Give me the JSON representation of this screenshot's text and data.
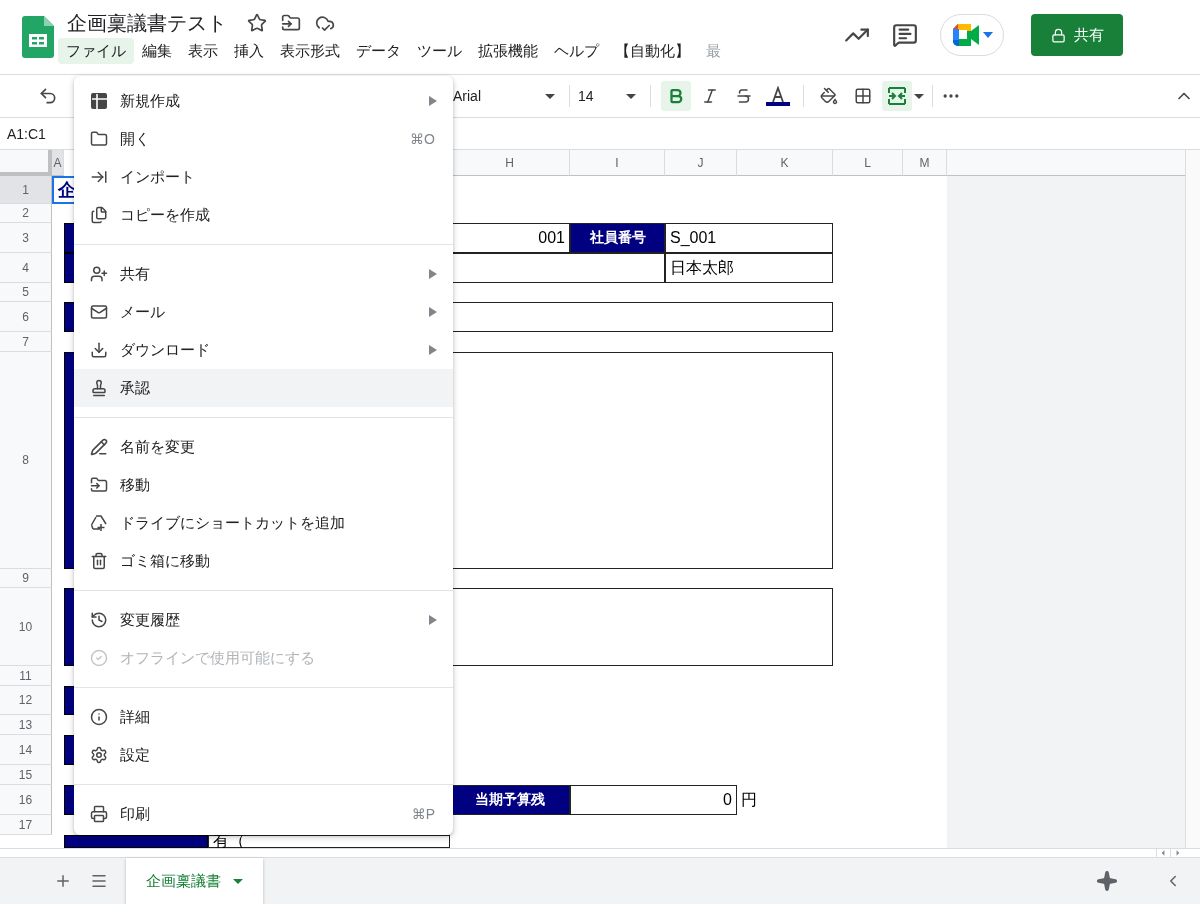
{
  "app": {
    "title": "企画稟議書テスト"
  },
  "menubar": [
    {
      "label": "ファイル",
      "selected": true
    },
    {
      "label": "編集",
      "selected": false
    },
    {
      "label": "表示",
      "selected": false
    },
    {
      "label": "挿入",
      "selected": false
    },
    {
      "label": "表示形式",
      "selected": false
    },
    {
      "label": "データ",
      "selected": false
    },
    {
      "label": "ツール",
      "selected": false
    },
    {
      "label": "拡張機能",
      "selected": false
    },
    {
      "label": "ヘルプ",
      "selected": false
    },
    {
      "label": "【自動化】",
      "selected": false
    },
    {
      "label": "最",
      "selected": false
    }
  ],
  "share_button": {
    "label": "共有"
  },
  "toolbar": {
    "font": "Arial",
    "font_size": "14",
    "bold": true,
    "italic": false,
    "strikethrough": false,
    "merge": true
  },
  "name_box": "A1:C1",
  "sheet": {
    "column_headers": [
      {
        "label": "A",
        "selected": true
      },
      {
        "label": "H",
        "selected": false
      },
      {
        "label": "I",
        "selected": false
      },
      {
        "label": "J",
        "selected": false
      },
      {
        "label": "K",
        "selected": false
      },
      {
        "label": "L",
        "selected": false
      },
      {
        "label": "M",
        "selected": false
      }
    ],
    "row_headers": [
      {
        "label": "1",
        "selected": true
      },
      {
        "label": "2",
        "selected": false
      },
      {
        "label": "3",
        "selected": false
      },
      {
        "label": "4",
        "selected": false
      },
      {
        "label": "5",
        "selected": false
      },
      {
        "label": "6",
        "selected": false
      },
      {
        "label": "7",
        "selected": false
      },
      {
        "label": "8",
        "selected": false
      },
      {
        "label": "9",
        "selected": false
      },
      {
        "label": "10",
        "selected": false
      },
      {
        "label": "11",
        "selected": false
      },
      {
        "label": "12",
        "selected": false
      },
      {
        "label": "13",
        "selected": false
      },
      {
        "label": "14",
        "selected": false
      },
      {
        "label": "15",
        "selected": false
      },
      {
        "label": "16",
        "selected": false
      },
      {
        "label": "17",
        "selected": false
      }
    ],
    "cells": [
      {
        "text": "企",
        "kind": "title",
        "selected": true
      },
      {
        "text": "001",
        "kind": "number",
        "selected": false
      },
      {
        "text": "社員番号",
        "kind": "label",
        "selected": false
      },
      {
        "text": "S_001",
        "kind": "text",
        "selected": false
      },
      {
        "text": "日本太郎",
        "kind": "text",
        "selected": false
      },
      {
        "text": "当期予算残",
        "kind": "label",
        "selected": false
      },
      {
        "text": "0",
        "kind": "number",
        "selected": false
      },
      {
        "text": "円",
        "kind": "unit",
        "selected": false
      },
      {
        "text": "有（",
        "kind": "text",
        "selected": false
      }
    ]
  },
  "file_menu": {
    "sections": [
      [
        {
          "label": "新規作成",
          "submenu": true,
          "highlighted": false,
          "disabled": false
        },
        {
          "label": "開く",
          "shortcut": "⌘O",
          "submenu": false,
          "highlighted": false,
          "disabled": false
        },
        {
          "label": "インポート",
          "submenu": false,
          "highlighted": false,
          "disabled": false
        },
        {
          "label": "コピーを作成",
          "submenu": false,
          "highlighted": false,
          "disabled": false
        }
      ],
      [
        {
          "label": "共有",
          "submenu": true,
          "highlighted": false,
          "disabled": false
        },
        {
          "label": "メール",
          "submenu": true,
          "highlighted": false,
          "disabled": false
        },
        {
          "label": "ダウンロード",
          "submenu": true,
          "highlighted": false,
          "disabled": false
        },
        {
          "label": "承認",
          "submenu": false,
          "highlighted": true,
          "disabled": false
        }
      ],
      [
        {
          "label": "名前を変更",
          "submenu": false,
          "highlighted": false,
          "disabled": false
        },
        {
          "label": "移動",
          "submenu": false,
          "highlighted": false,
          "disabled": false
        },
        {
          "label": "ドライブにショートカットを追加",
          "submenu": false,
          "highlighted": false,
          "disabled": false
        },
        {
          "label": "ゴミ箱に移動",
          "submenu": false,
          "highlighted": false,
          "disabled": false
        }
      ],
      [
        {
          "label": "変更履歴",
          "submenu": true,
          "highlighted": false,
          "disabled": false
        },
        {
          "label": "オフラインで使用可能にする",
          "submenu": false,
          "highlighted": false,
          "disabled": true
        }
      ],
      [
        {
          "label": "詳細",
          "submenu": false,
          "highlighted": false,
          "disabled": false
        },
        {
          "label": "設定",
          "submenu": false,
          "highlighted": false,
          "disabled": false
        }
      ],
      [
        {
          "label": "印刷",
          "shortcut": "⌘P",
          "submenu": false,
          "highlighted": false,
          "disabled": false
        }
      ]
    ]
  },
  "sheet_tabs": [
    {
      "label": "企画稟議書",
      "selected": true
    }
  ]
}
